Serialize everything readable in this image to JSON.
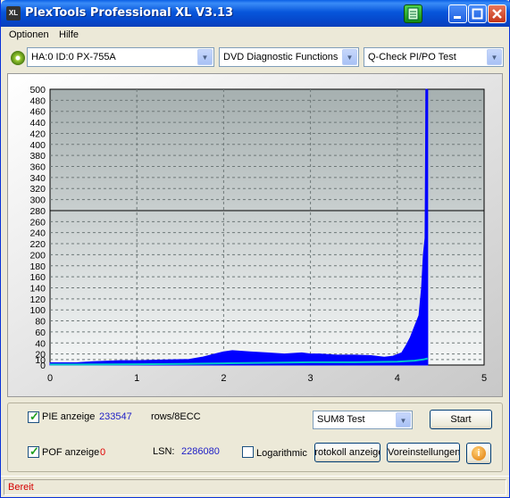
{
  "app": {
    "title": "PlexTools Professional XL V3.13",
    "logo_text": "XL"
  },
  "menu": [
    "Optionen",
    "Hilfe"
  ],
  "toolbar": {
    "drive": "HA:0 ID:0  PX-755A",
    "function": "DVD Diagnostic Functions",
    "test": "Q-Check PI/PO Test"
  },
  "chart_data": {
    "type": "area",
    "x_ticks": [
      "0",
      "1",
      "2",
      "3",
      "4",
      "5"
    ],
    "y_ticks": [
      "0",
      "10",
      "20",
      "40",
      "60",
      "80",
      "100",
      "120",
      "140",
      "160",
      "180",
      "200",
      "220",
      "240",
      "260",
      "280",
      "300",
      "320",
      "340",
      "360",
      "380",
      "400",
      "420",
      "440",
      "460",
      "480",
      "500"
    ],
    "xlim": [
      0,
      5
    ],
    "ylim": [
      0,
      500
    ],
    "threshold_line": 280,
    "series": [
      {
        "name": "PIE",
        "color": "#0000ff",
        "x": [
          0,
          0.3,
          0.5,
          0.8,
          1.0,
          1.3,
          1.6,
          1.75,
          1.9,
          2.0,
          2.1,
          2.3,
          2.5,
          2.7,
          2.9,
          3.0,
          3.1,
          3.3,
          3.5,
          3.7,
          3.85,
          3.95,
          4.05,
          4.1,
          4.15,
          4.2,
          4.25,
          4.28,
          4.3,
          4.32,
          4.33,
          4.34,
          4.35
        ],
        "y": [
          4,
          4,
          6,
          8,
          8,
          9,
          10,
          14,
          20,
          24,
          26,
          24,
          22,
          20,
          22,
          20,
          20,
          18,
          18,
          17,
          14,
          16,
          22,
          35,
          50,
          70,
          90,
          140,
          200,
          230,
          500,
          500,
          0
        ]
      },
      {
        "name": "PIF",
        "color": "#00c8c8",
        "x": [
          0,
          0.5,
          1.0,
          1.5,
          2.0,
          2.5,
          3.0,
          3.5,
          4.0,
          4.2,
          4.3,
          4.35
        ],
        "y": [
          1,
          1,
          1.5,
          2,
          3,
          4,
          5,
          5,
          6,
          8,
          10,
          12
        ]
      }
    ]
  },
  "panel": {
    "pie_label": "PIE anzeigen",
    "pie_value": "233547",
    "pie_unit": "rows/8ECC",
    "pof_label": "POF anzeige",
    "pof_value": "0",
    "lsn_label": "LSN:",
    "lsn_value": "2286080",
    "log_label": "Logarithmic",
    "sum_select": "SUM8 Test",
    "start_button": "Start",
    "protocol_button": "Protokoll anzeigen",
    "preset_button": "Voreinstellungen",
    "info_icon": "i"
  },
  "status": {
    "text": "Bereit"
  }
}
